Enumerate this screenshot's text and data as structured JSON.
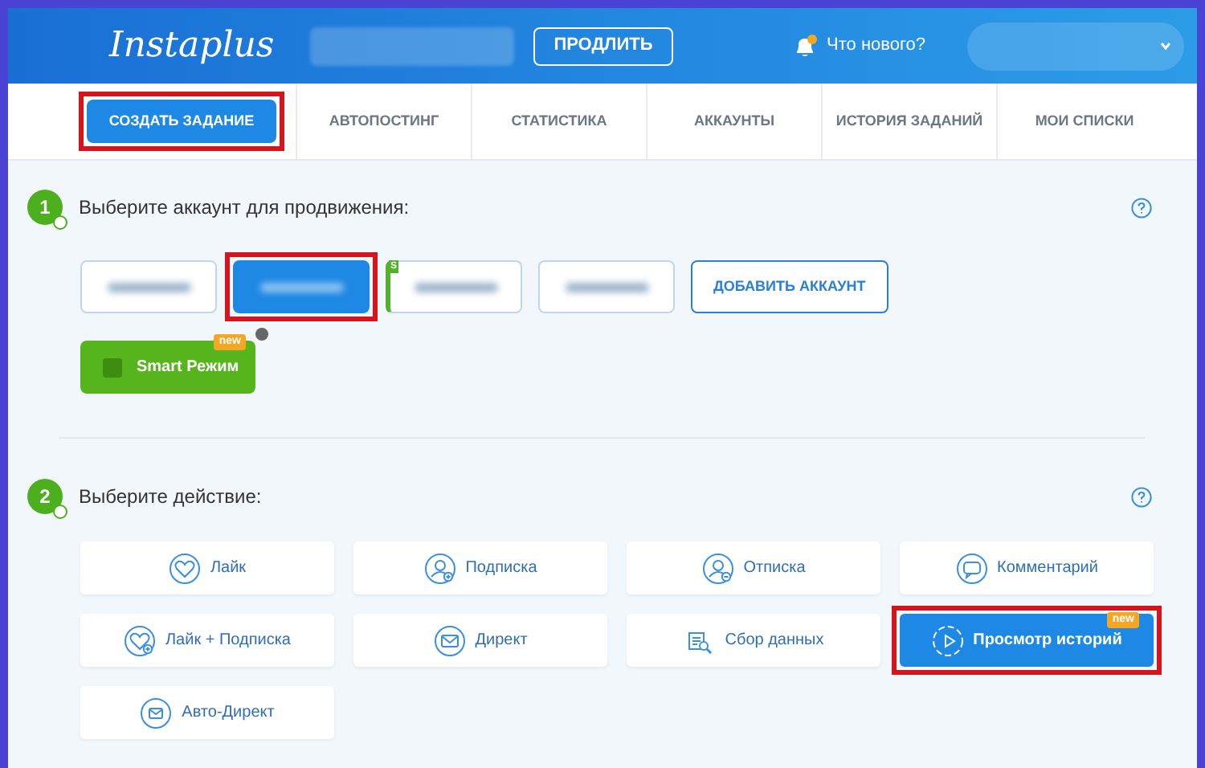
{
  "header": {
    "logo": "Instaplus",
    "renew_button": "ПРОДЛИТЬ",
    "notifications": {
      "label": "Что нового?",
      "unread": true
    }
  },
  "nav": [
    {
      "label": "СОЗДАТЬ ЗАДАНИЕ",
      "selected": true,
      "highlighted": true
    },
    {
      "label": "АВТОПОСТИНГ",
      "selected": false,
      "highlighted": false
    },
    {
      "label": "СТАТИСТИКА",
      "selected": false,
      "highlighted": false
    },
    {
      "label": "АККАУНТЫ",
      "selected": false,
      "highlighted": false
    },
    {
      "label": "ИСТОРИЯ ЗАДАНИЙ",
      "selected": false,
      "highlighted": false
    },
    {
      "label": "МОИ СПИСКИ",
      "selected": false,
      "highlighted": false
    }
  ],
  "step1": {
    "number": "1",
    "title": "Выберите аккаунт для продвижения:",
    "accounts": [
      {
        "selected": false,
        "highlighted": false
      },
      {
        "selected": true,
        "highlighted": true
      },
      {
        "selected": false,
        "highlighted": false,
        "badge": "S"
      },
      {
        "selected": false,
        "highlighted": false
      }
    ],
    "add_account": "ДОБАВИТЬ АККАУНТ",
    "smart_mode": {
      "label": "Smart Режим",
      "checked": false,
      "badge": "new"
    }
  },
  "step2": {
    "number": "2",
    "title": "Выберите действие:",
    "actions": [
      {
        "kind": "heart",
        "label": "Лайк",
        "selected": false,
        "highlighted": false
      },
      {
        "kind": "user-plus",
        "label": "Подписка",
        "selected": false,
        "highlighted": false
      },
      {
        "kind": "user-minus",
        "label": "Отписка",
        "selected": false,
        "highlighted": false
      },
      {
        "kind": "comment",
        "label": "Комментарий",
        "selected": false,
        "highlighted": false
      },
      {
        "kind": "heart-plus",
        "label": "Лайк + Подписка",
        "selected": false,
        "highlighted": false
      },
      {
        "kind": "mail",
        "label": "Директ",
        "selected": false,
        "highlighted": false
      },
      {
        "kind": "data",
        "label": "Сбор данных",
        "selected": false,
        "highlighted": false
      },
      {
        "kind": "play",
        "label": "Просмотр историй",
        "selected": true,
        "highlighted": true,
        "badge": "new"
      },
      {
        "kind": "mail-cycle",
        "label": "Авто-Директ",
        "selected": false,
        "highlighted": false
      }
    ]
  }
}
